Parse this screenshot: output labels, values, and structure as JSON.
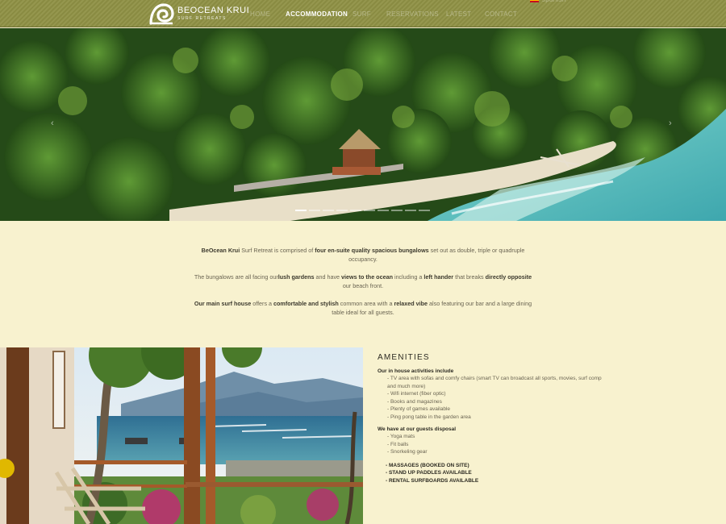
{
  "brand": {
    "name": "BEOCEAN KRUI",
    "tagline": "SURF RETREATS"
  },
  "nav": {
    "items": [
      {
        "label": "HOME",
        "active": false
      },
      {
        "label": "ACCOMMODATION",
        "active": true
      },
      {
        "label": "SURF",
        "active": false
      },
      {
        "label": "RESERVATIONS",
        "active": false
      },
      {
        "label": "LATEST",
        "active": false
      },
      {
        "label": "CONTACT",
        "active": false
      }
    ],
    "language": "spanish"
  },
  "hero": {
    "prev": "‹",
    "next": "›",
    "slide_count": 10,
    "active_slide": 1
  },
  "intro": {
    "p1": {
      "a": "BeOcean Krui",
      "b": " Surf Retreat is comprised of ",
      "c": "four en-suite quality spacious bungalows",
      "d": " set out as double, triple or quadruple occupancy."
    },
    "p2": {
      "a": "The bungalows are all facing our",
      "b": "lush gardens",
      "c": " and have ",
      "d": "views to the ocean",
      "e": " including a ",
      "f": "left hander",
      "g": " that breaks ",
      "h": "directly opposite",
      "i": " our beach front."
    },
    "p3": {
      "a": "Our main surf house",
      "b": " offers a ",
      "c": "comfortable and stylish",
      "d": " common area with a ",
      "e": "relaxed vibe",
      "f": " also featuring our bar and a large dining table ideal for all guests."
    }
  },
  "amenities": {
    "title": "AMENITIES",
    "in_house_heading": "Our in house activities include",
    "in_house": [
      "- TV area with sofas and comfy chairs (smart TV can broadcast all sports, movies, surf comp and much more)",
      "- Wifi internet (fiber optic)",
      "- Books and magazines",
      "- Plenty of games available",
      "- Ping pong table in the garden area"
    ],
    "disposal_heading": "We have at our guests disposal",
    "disposal": [
      "- Yoga mats",
      "- Fit balls",
      "- Snorkeling gear"
    ],
    "extras": [
      "- MASSAGES (BOOKED ON SITE)",
      "- STAND UP PADDLES AVAILABLE",
      "- RENTAL SURFBOARDS AVAILABLE"
    ]
  },
  "colors": {
    "nav_bg": "#8f9145",
    "page_bg": "#f8f2cf",
    "text": "#6a6452",
    "heading": "#2c2a22"
  }
}
